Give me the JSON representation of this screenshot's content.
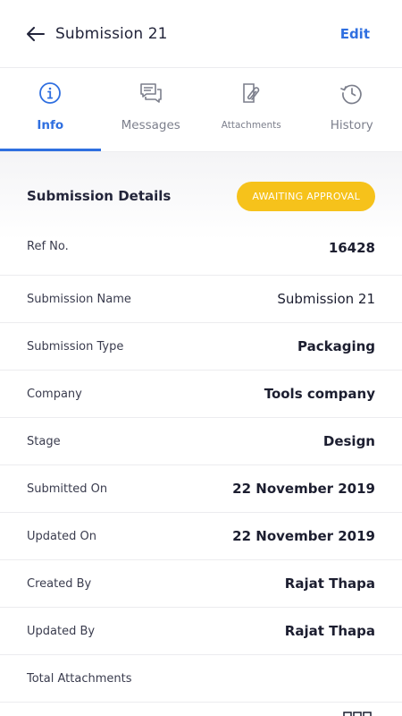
{
  "header": {
    "title": "Submission 21",
    "edit_label": "Edit"
  },
  "tabs": [
    {
      "label": "Info",
      "icon": "info-icon",
      "active": true
    },
    {
      "label": "Messages",
      "icon": "messages-icon",
      "active": false
    },
    {
      "label": "Attachments",
      "icon": "attachment-icon",
      "active": false
    },
    {
      "label": "History",
      "icon": "history-icon",
      "active": false
    }
  ],
  "details": {
    "title": "Submission Details",
    "status": "AWAITING APPROVAL",
    "status_color": "#f6c21b",
    "accent_color": "#2f6fe0",
    "rows": [
      {
        "label": "Ref No.",
        "value": "16428"
      },
      {
        "label": "Submission Name",
        "value": "Submission 21"
      },
      {
        "label": "Submission Type",
        "value": "Packaging"
      },
      {
        "label": "Company",
        "value": "Tools company"
      },
      {
        "label": "Stage",
        "value": "Design"
      },
      {
        "label": "Submitted On",
        "value": "22 November 2019"
      },
      {
        "label": "Updated On",
        "value": "22 November 2019"
      },
      {
        "label": "Created By",
        "value": "Rajat Thapa"
      },
      {
        "label": "Updated By",
        "value": "Rajat Thapa"
      },
      {
        "label": "Total Attachments",
        "value": ""
      }
    ]
  }
}
